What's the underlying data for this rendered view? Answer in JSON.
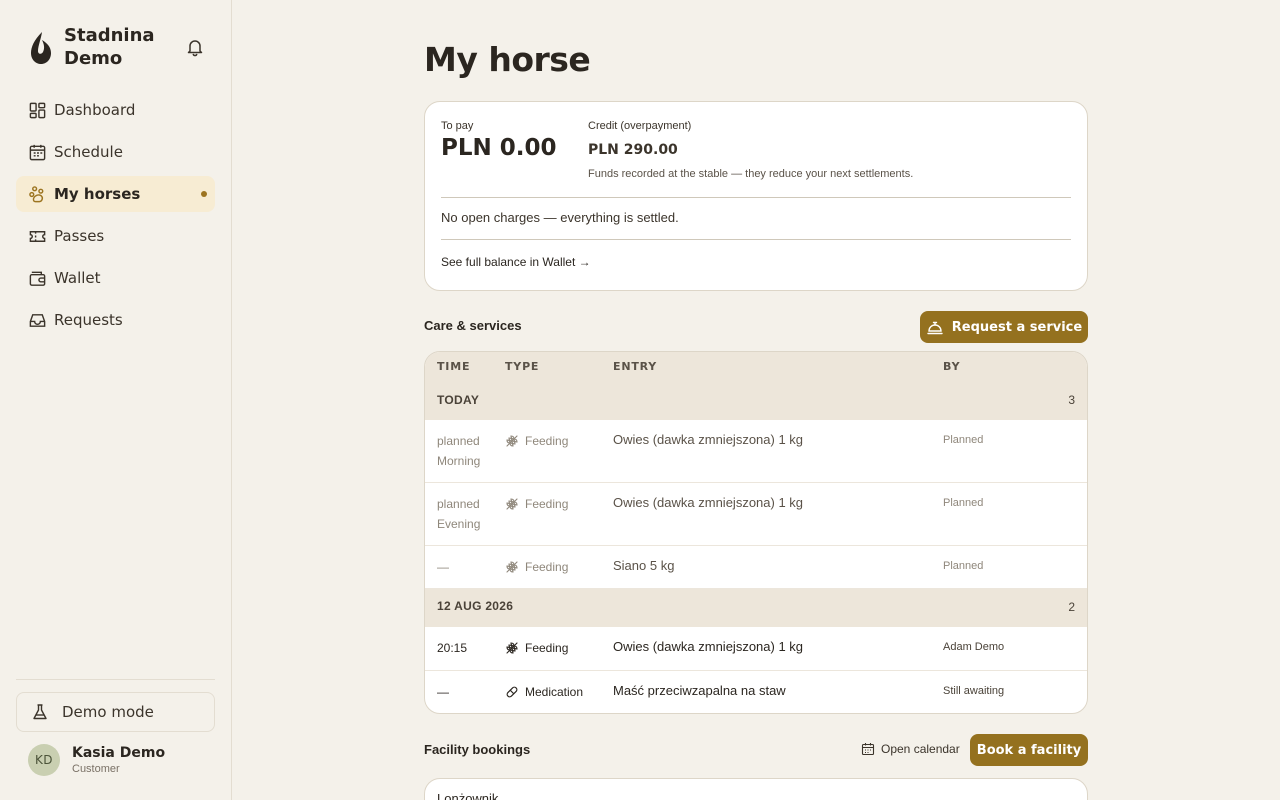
{
  "sidebar": {
    "brand": "Stadnina Demo",
    "nav": [
      {
        "label": "Dashboard"
      },
      {
        "label": "Schedule"
      },
      {
        "label": "My horses"
      },
      {
        "label": "Passes"
      },
      {
        "label": "Wallet"
      },
      {
        "label": "Requests"
      }
    ],
    "demo_mode": "Demo mode",
    "user": {
      "initials": "KD",
      "name": "Kasia Demo",
      "role": "Customer"
    }
  },
  "page": {
    "title": "My horse"
  },
  "balance": {
    "to_pay_label": "To pay",
    "to_pay_value": "PLN 0.00",
    "credit_label": "Credit (overpayment)",
    "credit_value": "PLN 290.00",
    "credit_note": "Funds recorded at the stable — they reduce your next settlements.",
    "status": "No open charges — everything is settled.",
    "wallet_link": "See full balance in Wallet →"
  },
  "care": {
    "title": "Care & services",
    "request_button": "Request a service",
    "columns": [
      "TIME",
      "TYPE",
      "ENTRY",
      "BY"
    ],
    "groups": [
      {
        "label": "TODAY",
        "count": "3",
        "rows": [
          {
            "time": "planned",
            "time2": "Morning",
            "type": "Feeding",
            "entry": "Owies (dawka zmniejszona) 1 kg",
            "by": "Planned"
          },
          {
            "time": "planned",
            "time2": "Evening",
            "type": "Feeding",
            "entry": "Owies (dawka zmniejszona) 1 kg",
            "by": "Planned"
          },
          {
            "time": "—",
            "type": "Feeding",
            "entry": "Siano 5 kg",
            "by": "Planned"
          }
        ]
      },
      {
        "label": "12 AUG 2026",
        "count": "2",
        "rows": [
          {
            "time": "20:15",
            "type": "Feeding",
            "entry": "Owies (dawka zmniejszona) 1 kg",
            "by": "Adam Demo"
          },
          {
            "time": "—",
            "type": "Medication",
            "entry": "Maść przeciwzapalna na staw",
            "by": "Still awaiting"
          }
        ]
      }
    ]
  },
  "bookings": {
    "title": "Facility bookings",
    "open_calendar": "Open calendar",
    "book_button": "Book a facility",
    "first_item": "Lonżownik"
  },
  "colors": {
    "accent": "#94711f",
    "background": "#f4f1ea",
    "active_nav": "#f7ecd3"
  }
}
